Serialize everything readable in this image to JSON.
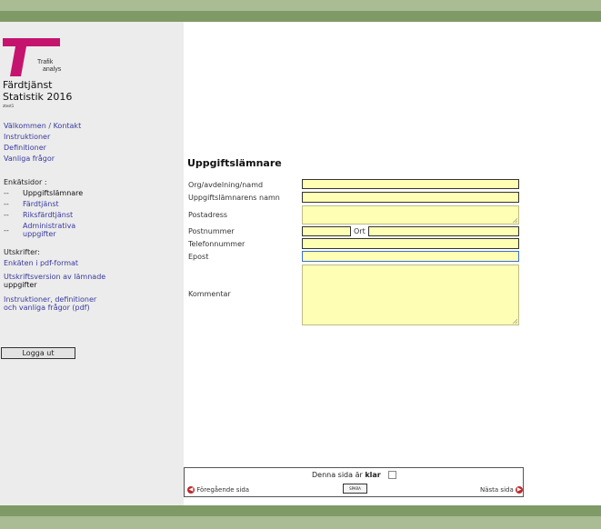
{
  "logo": {
    "line1": "Trafik",
    "line2": "analys",
    "accent": "#c5146e"
  },
  "app": {
    "title_line1": "Färdtjänst",
    "title_line2": "Statistik 2016",
    "user": "ztest1"
  },
  "nav": {
    "links": [
      "Välkommen / Kontakt",
      "Instruktioner",
      "Definitioner",
      "Vanliga frågor"
    ],
    "survey_heading": "Enkätsidor :",
    "survey_dash": "--",
    "survey_pages": [
      "Uppgiftslämnare",
      "Färdtjänst",
      "Riksfärdtjänst",
      "Administrativa",
      "uppgifter"
    ],
    "print_heading": "Utskrifter:",
    "print_links": [
      "Enkäten i pdf-format",
      "Utskriftsversion av lämnade",
      "uppgifter",
      "Instruktioner, definitioner",
      "och vanliga frågor (pdf)"
    ],
    "logout": "Logga ut"
  },
  "form": {
    "title": "Uppgiftslämnare",
    "labels": {
      "org": "Org/avdelning/namd",
      "name": "Uppgiftslämnarens namn",
      "address": "Postadress",
      "postnr": "Postnummer",
      "ort": "Ort",
      "phone": "Telefonnummer",
      "email": "Epost",
      "comment": "Kommentar"
    },
    "values": {
      "org": "",
      "name": "",
      "address": "",
      "postnr": "",
      "ort": "",
      "phone": "",
      "email": "",
      "comment": ""
    }
  },
  "footer": {
    "done_prefix": "Denna sida är ",
    "done_bold": "klar",
    "done_checked": false,
    "prev": "Föregående sida",
    "next": "Nästa sida",
    "save": "SPARA"
  },
  "colors": {
    "band_light": "#a9bc94",
    "band_dark": "#7f9a66",
    "field_bg": "#fefeb4",
    "nav_arrow": "#c0282b"
  }
}
